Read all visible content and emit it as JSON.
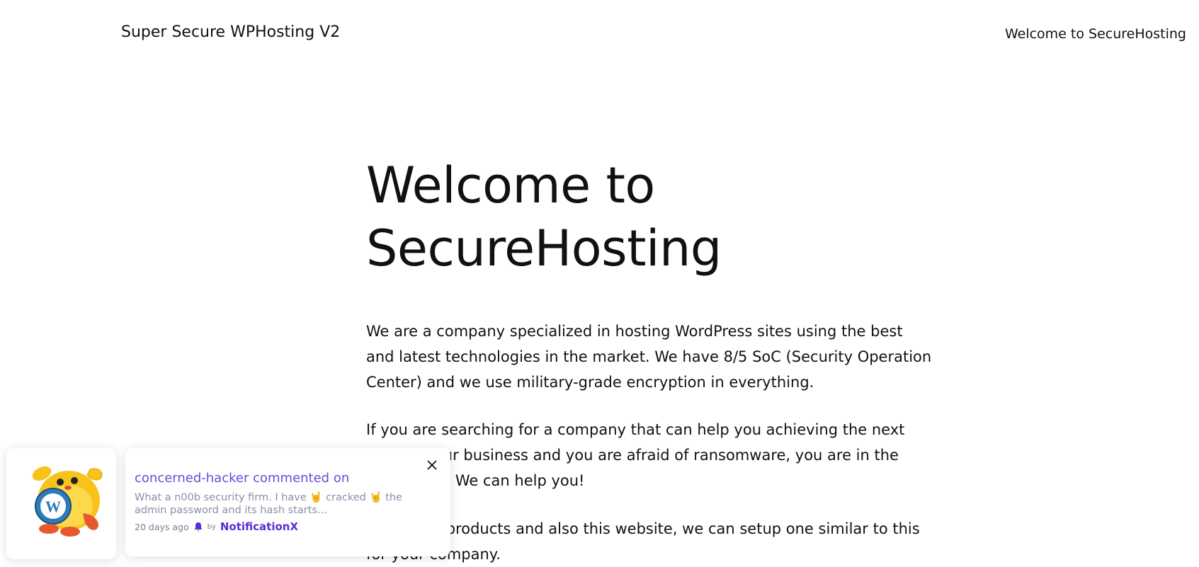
{
  "header": {
    "site_title": "Super Secure WPHosting V2",
    "nav": [
      {
        "label": "Welcome to SecureHosting"
      }
    ]
  },
  "main": {
    "title": "Welcome to SecureHosting",
    "paragraphs": [
      "We are a company specialized in hosting WordPress sites using the best and latest technologies in the market. We have 8/5 SoC (Security Operation Center) and we use military-grade encryption in everything.",
      "If you are searching for a company that can help you achieving the next level of your business and you are afraid of ransomware, you are in the right place. We can help you!",
      "Check our products and also this website, we can setup one similar to this for your company."
    ]
  },
  "notification": {
    "title": "concerned-hacker commented on",
    "body": "What a n00b security firm. I have 🤘 cracked 🤘 the admin password and its hash starts...",
    "time": "20 days ago",
    "by_label": "by",
    "brand": "NotificationX",
    "icons": {
      "avatar": "wapuu-wordpress-mascot",
      "close": "close-icon",
      "brand": "notificationx-logo-icon"
    },
    "colors": {
      "title": "#6a4bd8",
      "body": "#8a8fa8",
      "brand": "#5a2dd6"
    }
  }
}
